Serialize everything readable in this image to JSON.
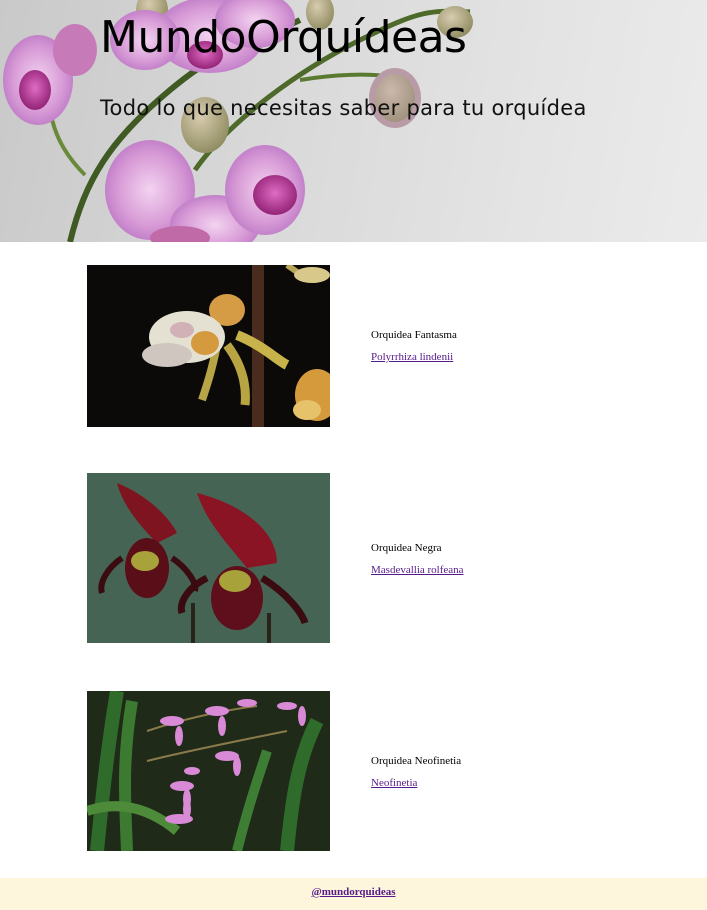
{
  "header": {
    "title": "MundoOrquídeas",
    "tagline": "Todo lo que necesitas saber para tu orquídea",
    "image": "orchid-banner-image"
  },
  "orchids": [
    {
      "common_name": "Orquidea Fantasma",
      "scientific_name": "Polyrrhiza lindenii",
      "image": "ghost-orchid-photo"
    },
    {
      "common_name": "Orquidea Negra",
      "scientific_name": "Masdevallia rolfeana",
      "image": "black-orchid-photo"
    },
    {
      "common_name": "Orquidea Neofinetia",
      "scientific_name": "Neofinetia",
      "image": "neofinetia-photo"
    }
  ],
  "footer": {
    "handle": "@mundorquideas",
    "background": "#fdf6dc"
  },
  "colors": {
    "link_visited": "#551a8b",
    "page_background": "#ffffff"
  }
}
